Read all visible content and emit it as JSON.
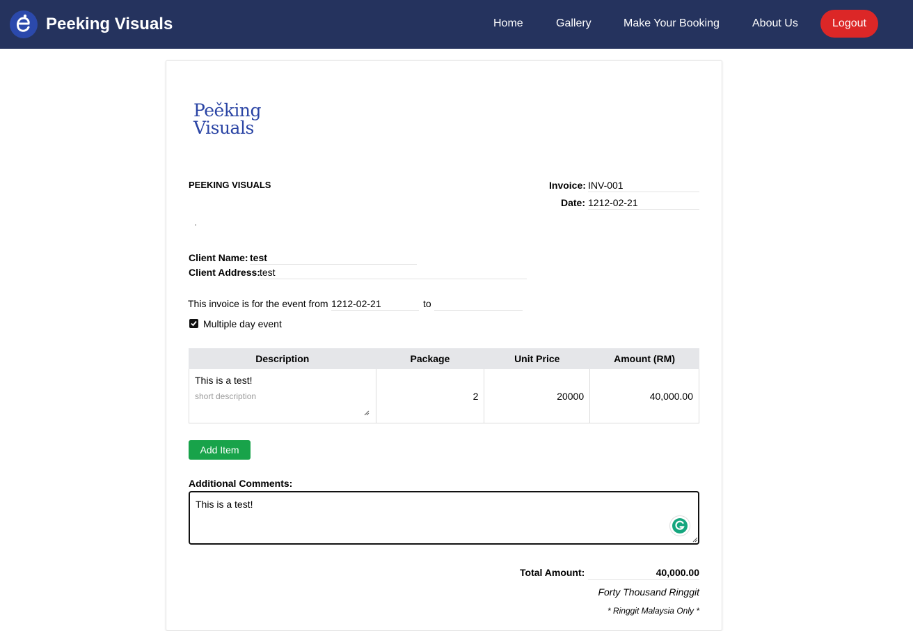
{
  "navbar": {
    "brand": "Peeking Visuals",
    "links": [
      "Home",
      "Gallery",
      "Make Your Booking",
      "About Us"
    ],
    "logout": "Logout"
  },
  "invoice": {
    "logo_line1": "Peěking",
    "logo_line2": "Visuals",
    "company_name": "PEEKING VISUALS",
    "invoice_label": "Invoice:",
    "invoice_number": "INV-001",
    "date_label": "Date:",
    "date": "1212-02-21",
    "client_name_label": "Client Name:",
    "client_name": "test",
    "client_address_label": "Client Address:",
    "client_address": "test",
    "event_text": "This invoice is for the event from",
    "event_from": "1212-02-21",
    "event_to_label": "to",
    "event_to": "",
    "multiple_day_label": "Multiple day event",
    "multiple_day_checked": true,
    "table": {
      "headers": [
        "Description",
        "Package",
        "Unit Price",
        "Amount (RM)"
      ],
      "rows": [
        {
          "description": "This is a test!",
          "description_placeholder": "short description",
          "package": "2",
          "unit_price": "20000",
          "amount": "40,000.00"
        }
      ]
    },
    "add_item": "Add Item",
    "comments_label": "Additional Comments:",
    "comments": "This is a test!",
    "total_label": "Total Amount:",
    "total_value": "40,000.00",
    "total_words": "Forty Thousand Ringgit",
    "currency_note": "* Ringgit Malaysia Only *"
  },
  "colors": {
    "navbar_bg": "#25335e",
    "logout_bg": "#dc2727",
    "add_button_bg": "#18a34a",
    "logo_text": "#2a44a4"
  }
}
